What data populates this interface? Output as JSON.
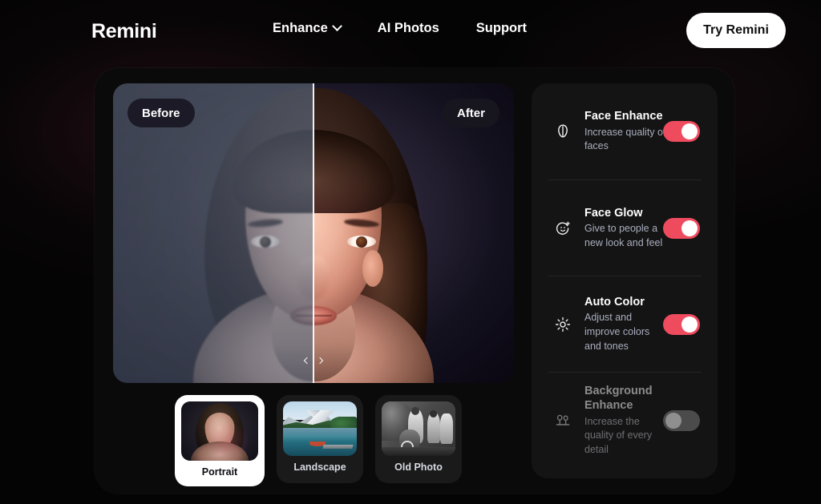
{
  "nav": {
    "logo": "Remini",
    "links": [
      {
        "label": "Enhance",
        "has_chevron": true,
        "icon": "chevron-down-icon"
      },
      {
        "label": "AI Photos",
        "has_chevron": false
      },
      {
        "label": "Support",
        "has_chevron": false
      }
    ],
    "cta_label": "Try Remini"
  },
  "comparison": {
    "before_label": "Before",
    "after_label": "After",
    "slider_position_percent": 50,
    "handle_left_icon": "chevron-left-icon",
    "handle_right_icon": "chevron-right-icon"
  },
  "thumbnails": [
    {
      "label": "Portrait",
      "selected": true
    },
    {
      "label": "Landscape",
      "selected": false
    },
    {
      "label": "Old Photo",
      "selected": false
    }
  ],
  "settings": [
    {
      "title": "Face Enhance",
      "description": "Increase quality of faces",
      "icon": "face-oval-icon",
      "enabled": true
    },
    {
      "title": "Face Glow",
      "description": "Give to people a new look and feel",
      "icon": "face-sparkle-icon",
      "enabled": true
    },
    {
      "title": "Auto Color",
      "description": "Adjust and improve colors and tones",
      "icon": "brightness-sun-icon",
      "enabled": true
    },
    {
      "title": "Background Enhance",
      "description": "Increase the quality of every detail",
      "icon": "trees-landscape-icon",
      "enabled": false
    }
  ],
  "colors": {
    "page_background": "#040404",
    "card_background": "#0a0a0a",
    "panel_background": "#141414",
    "toggle_on": "#ee4b5e",
    "toggle_off": "#4b4b4b",
    "accent_text": "#ffffff",
    "muted_text": "#a9aebe",
    "cta_background": "#ffffff"
  }
}
